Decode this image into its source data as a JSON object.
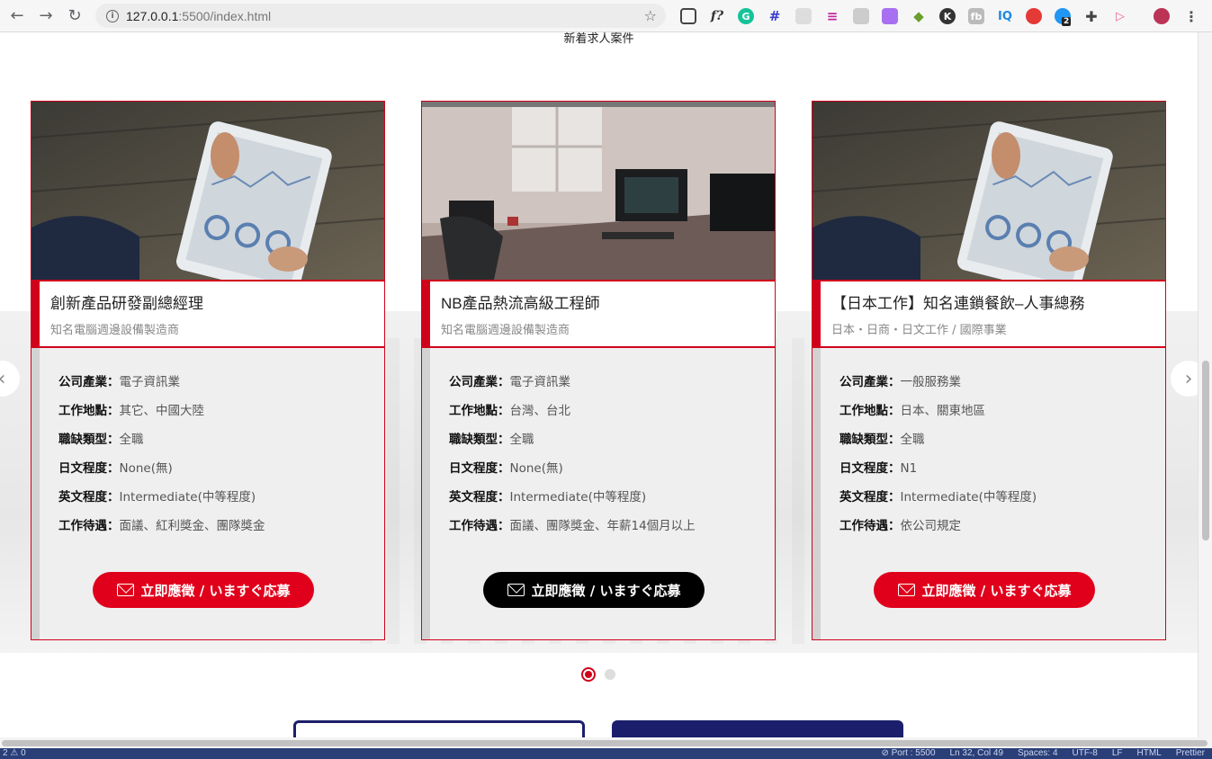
{
  "browser": {
    "url_host": "127.0.0.1",
    "url_rest": ":5500/index.html",
    "extension_badge": "2"
  },
  "section_caption": "新着求人案件",
  "cards": [
    {
      "title": "創新產品研發副總經理",
      "company": "知名電腦週邊設備製造商",
      "rows": [
        {
          "k": "公司產業：",
          "v": "電子資訊業"
        },
        {
          "k": "工作地點：",
          "v": "其它、中國大陸"
        },
        {
          "k": "職缺類型：",
          "v": "全職"
        },
        {
          "k": "日文程度：",
          "v": "None(無)"
        },
        {
          "k": "英文程度：",
          "v": "Intermediate(中等程度)"
        },
        {
          "k": "工作待遇：",
          "v": "面議、紅利獎金、團隊獎金"
        }
      ],
      "apply": "立即應徵 / いますぐ応募"
    },
    {
      "title": "NB產品熱流高級工程師",
      "company": "知名電腦週邊設備製造商",
      "rows": [
        {
          "k": "公司產業：",
          "v": "電子資訊業"
        },
        {
          "k": "工作地點：",
          "v": "台灣、台北"
        },
        {
          "k": "職缺類型：",
          "v": "全職"
        },
        {
          "k": "日文程度：",
          "v": "None(無)"
        },
        {
          "k": "英文程度：",
          "v": "Intermediate(中等程度)"
        },
        {
          "k": "工作待遇：",
          "v": "面議、團隊獎金、年薪14個月以上"
        }
      ],
      "apply": "立即應徵 / いますぐ応募"
    },
    {
      "title": "【日本工作】知名連鎖餐飲–人事總務",
      "company": "日本・日商・日文工作 / 國際事業",
      "rows": [
        {
          "k": "公司產業：",
          "v": "一般服務業"
        },
        {
          "k": "工作地點：",
          "v": "日本、關東地區"
        },
        {
          "k": "職缺類型：",
          "v": "全職"
        },
        {
          "k": "日文程度：",
          "v": "N1"
        },
        {
          "k": "英文程度：",
          "v": "Intermediate(中等程度)"
        },
        {
          "k": "工作待遇：",
          "v": "依公司規定"
        }
      ],
      "apply": "立即應徵 / いますぐ応募"
    }
  ],
  "status_bar": {
    "left": "2 ⚠ 0",
    "port": "⊘ Port : 5500",
    "position": "Ln 32, Col 49",
    "spaces": "Spaces: 4",
    "encoding": "UTF-8",
    "eol": "LF",
    "language": "HTML",
    "formatter": "Prettier"
  }
}
